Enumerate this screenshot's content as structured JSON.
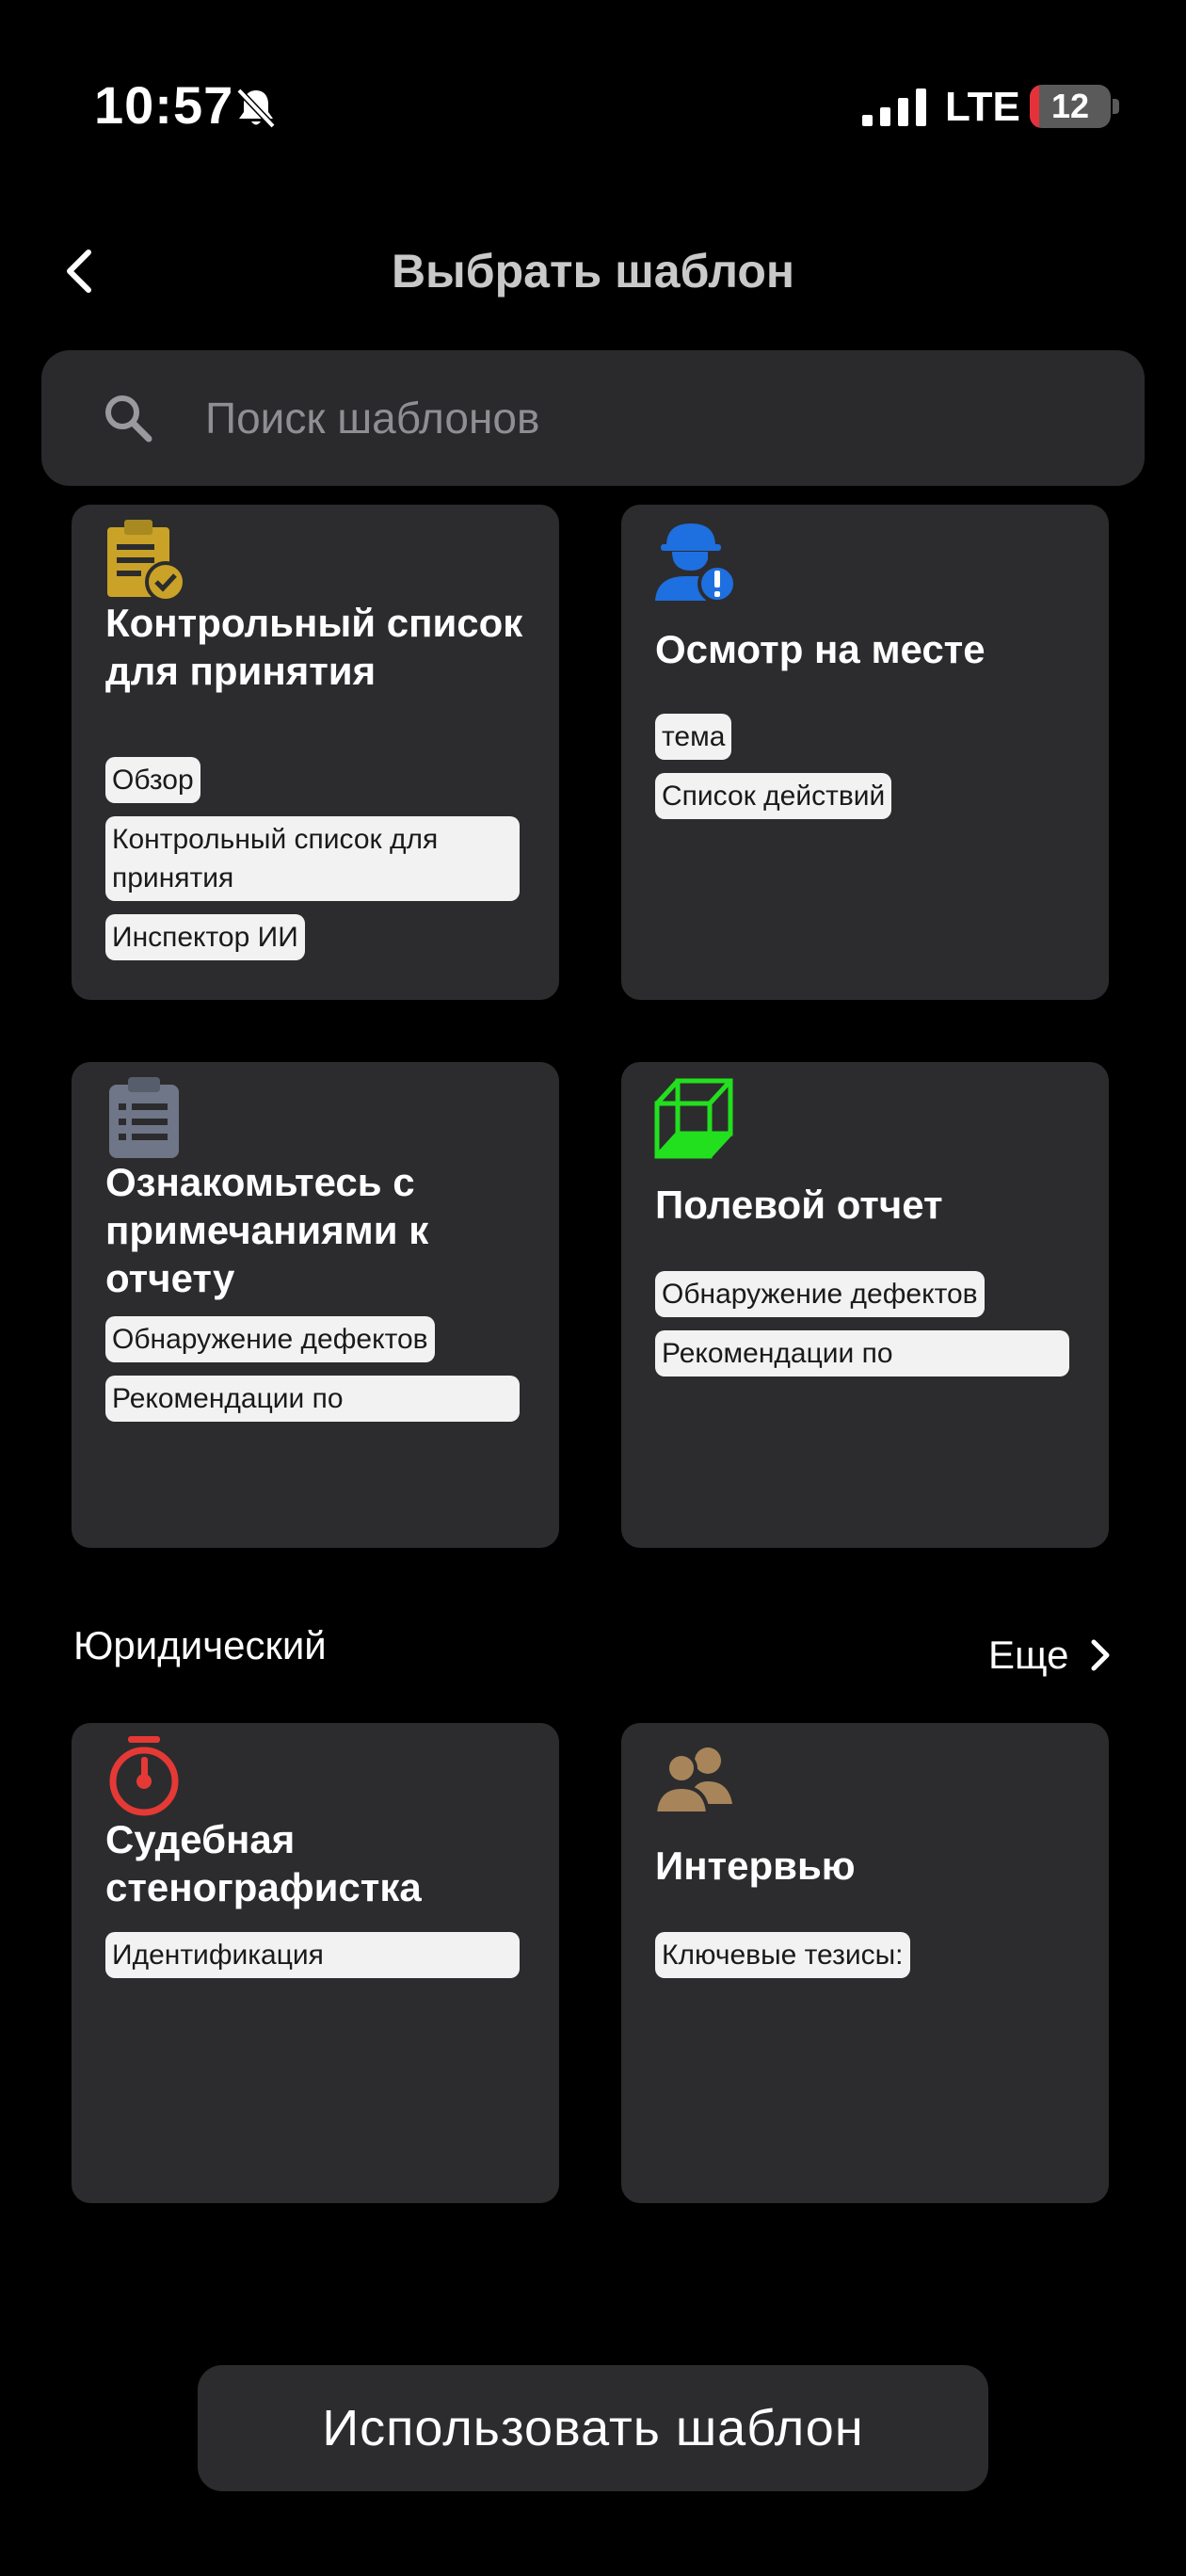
{
  "status_bar": {
    "time": "10:57",
    "network": "LTE",
    "battery": "12",
    "battery_level": 0.12
  },
  "header": {
    "title": "Выбрать шаблон"
  },
  "search": {
    "placeholder": "Поиск шаблонов"
  },
  "cards": [
    {
      "title": "Контрольный список для принятия",
      "icon": "clipboard-check-icon",
      "icon_color": "#c9a227",
      "tags": [
        "Обзор",
        "Контрольный список для принятия",
        "Инспектор ИИ"
      ]
    },
    {
      "title": "Осмотр на месте",
      "icon": "worker-alert-icon",
      "icon_color": "#1e6fe0",
      "tags": [
        "тема",
        "Список действий"
      ]
    },
    {
      "title": "Ознакомьтесь с примечаниями к отчету",
      "icon": "clipboard-list-icon",
      "icon_color": "#6e7687",
      "tags": [
        "Обнаружение дефектов",
        "Рекомендации по"
      ]
    },
    {
      "title": "Полевой отчет",
      "icon": "cube-icon",
      "icon_color": "#22e01e",
      "tags": [
        "Обнаружение дефектов",
        "Рекомендации по"
      ]
    }
  ],
  "legal_section": {
    "title": "Юридический",
    "more_label": "Еще",
    "cards": [
      {
        "title": "Судебная стенографистка",
        "icon": "stopwatch-icon",
        "icon_color": "#e53935",
        "tags": [
          "Идентификация"
        ]
      },
      {
        "title": "Интервью",
        "icon": "users-icon",
        "icon_color": "#a8845a",
        "tags": [
          "Ключевые тезисы:"
        ]
      }
    ]
  },
  "footer": {
    "use_button_label": "Использовать шаблон"
  }
}
